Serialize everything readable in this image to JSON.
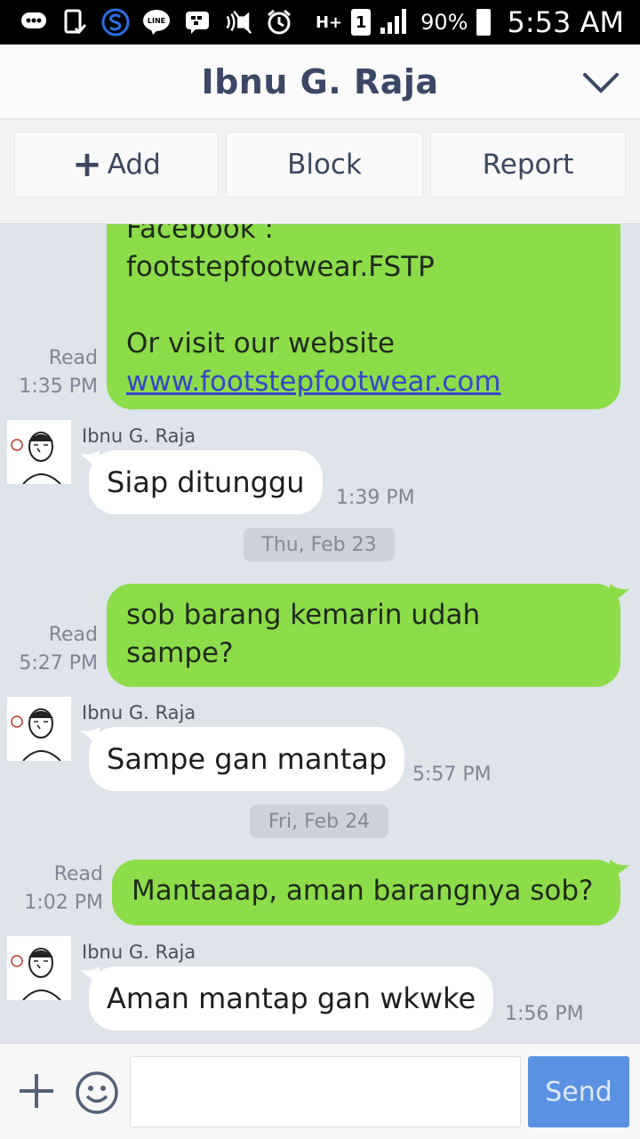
{
  "status_bar": {
    "battery": "90%",
    "time": "5:53 AM",
    "sim": "1",
    "network": "H+"
  },
  "header": {
    "title": "Ibnu G. Raja"
  },
  "actions": {
    "add": "Add",
    "block": "Block",
    "report": "Report"
  },
  "messages": {
    "m1": {
      "line1": "Facebook :",
      "line2": "footstepfootwear.FSTP",
      "line3": "Or visit our website",
      "link": "www.footstepfootwear.com",
      "status": "Read",
      "time": "1:35 PM"
    },
    "m2": {
      "sender": "Ibnu G. Raja",
      "text": "Siap ditunggu",
      "time": "1:39 PM"
    },
    "d1": "Thu, Feb 23",
    "m3": {
      "line1": "sob barang kemarin udah",
      "line2": "sampe?",
      "status": "Read",
      "time": "5:27 PM"
    },
    "m4": {
      "sender": "Ibnu G. Raja",
      "text": "Sampe gan mantap",
      "time": "5:57 PM"
    },
    "d2": "Fri, Feb 24",
    "m5": {
      "text": "Mantaaap, aman barangnya sob?",
      "status": "Read",
      "time": "1:02 PM"
    },
    "m6": {
      "sender": "Ibnu G. Raja",
      "text": "Aman mantap gan wkwke",
      "time": "1:56 PM"
    }
  },
  "input": {
    "value": "",
    "placeholder": "",
    "send": "Send"
  },
  "colors": {
    "outgoing_bubble": "#8ddc4a",
    "incoming_bubble": "#ffffff",
    "chat_bg": "#dfe3ea",
    "send_button": "#5b91e2",
    "title": "#3c4766"
  }
}
